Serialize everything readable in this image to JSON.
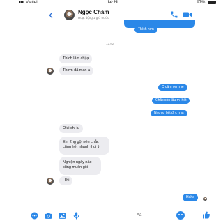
{
  "status_bar": {
    "carrier": "Viettel",
    "time": "14:21",
    "battery": "97%"
  },
  "header": {
    "back_glyph": "‹",
    "contact_name": "Ngọc Chăm",
    "contact_status": "Hoạt động 1 giờ trước"
  },
  "chat": {
    "timestamp": "12:02",
    "messages": [
      {
        "dir": "out",
        "text": "Thích hơn"
      },
      {
        "dir": "in",
        "text": "Thích lắm chị ạ"
      },
      {
        "dir": "in",
        "text": "Thơm dã man ạ"
      },
      {
        "dir": "out",
        "text": "C cảm ơn nhé"
      },
      {
        "dir": "out",
        "text": "Chắc còn lâu mí hết"
      },
      {
        "dir": "out",
        "text": "Nhưng hết đi c nha"
      },
      {
        "dir": "in",
        "text": "Okii chị iu"
      },
      {
        "dir": "in",
        "text": "Em 2ng gội nên chắc cũng hết nhanh thui ý"
      },
      {
        "dir": "in",
        "text": "Nghiện ngày nào cũng muốn gội"
      },
      {
        "dir": "in",
        "text": "Hihi"
      },
      {
        "dir": "out",
        "text": "Haha"
      }
    ]
  },
  "composer": {
    "text_style_label": "Aa"
  },
  "colors": {
    "accent": "#2b88e8",
    "incoming_bubble": "#ececf0",
    "back_blue": "#2b6fd6"
  },
  "icons": [
    "back-chevron-icon",
    "call-icon",
    "video-call-icon",
    "menu-dots-icon",
    "camera-icon",
    "image-icon",
    "mic-icon",
    "emoji-icon",
    "like-icon"
  ]
}
